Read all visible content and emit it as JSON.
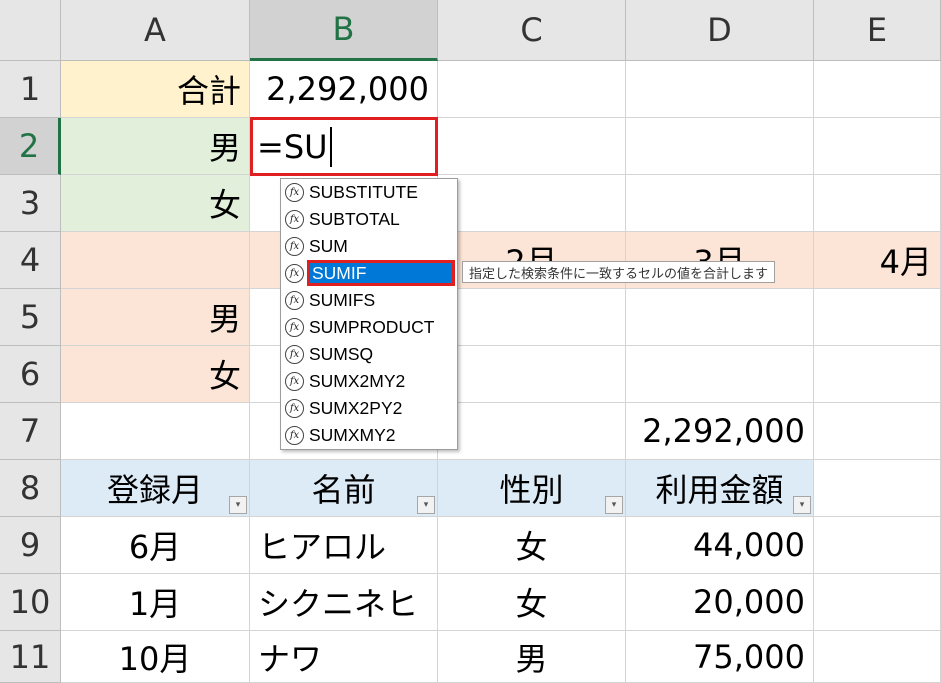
{
  "columns": [
    "A",
    "B",
    "C",
    "D",
    "E"
  ],
  "rows": [
    "1",
    "2",
    "3",
    "4",
    "5",
    "6",
    "7",
    "8",
    "9",
    "10",
    "11"
  ],
  "cells": {
    "a1": "合計",
    "b1": "2,292,000",
    "a2": "男",
    "a3": "女",
    "c4": "2月",
    "d4": "3月",
    "e4": "4月",
    "a5": "男",
    "a6": "女",
    "d7": "2,292,000",
    "a8": "登録月",
    "b8": "名前",
    "c8": "性別",
    "d8": "利用金額",
    "a9": "6月",
    "b9": "ヒアロル",
    "c9": "女",
    "d9": "44,000",
    "a10": "1月",
    "b10": "シクニネヒ",
    "c10": "女",
    "d10": "20,000",
    "a11": "10月",
    "b11": "ナワ",
    "c11": "男",
    "d11": "75,000"
  },
  "editing": {
    "cell": "B2",
    "value": "=SU"
  },
  "autocomplete": {
    "items": [
      "SUBSTITUTE",
      "SUBTOTAL",
      "SUM",
      "SUMIF",
      "SUMIFS",
      "SUMPRODUCT",
      "SUMSQ",
      "SUMX2MY2",
      "SUMX2PY2",
      "SUMXMY2"
    ],
    "selected": "SUMIF",
    "icon_glyph": "fx",
    "tooltip": "指定した検索条件に一致するセルの値を合計します"
  },
  "filter_glyph": "▾",
  "colors": {
    "header_bg": "#e6e6e6",
    "selected_header_accent": "#217346",
    "total_fill": "#fff2cc",
    "gender_fill": "#e2efda",
    "month_fill": "#fce4d6",
    "table_header_fill": "#ddebf7",
    "selection_highlight": "#0078d7",
    "red_outline": "#e02020"
  }
}
